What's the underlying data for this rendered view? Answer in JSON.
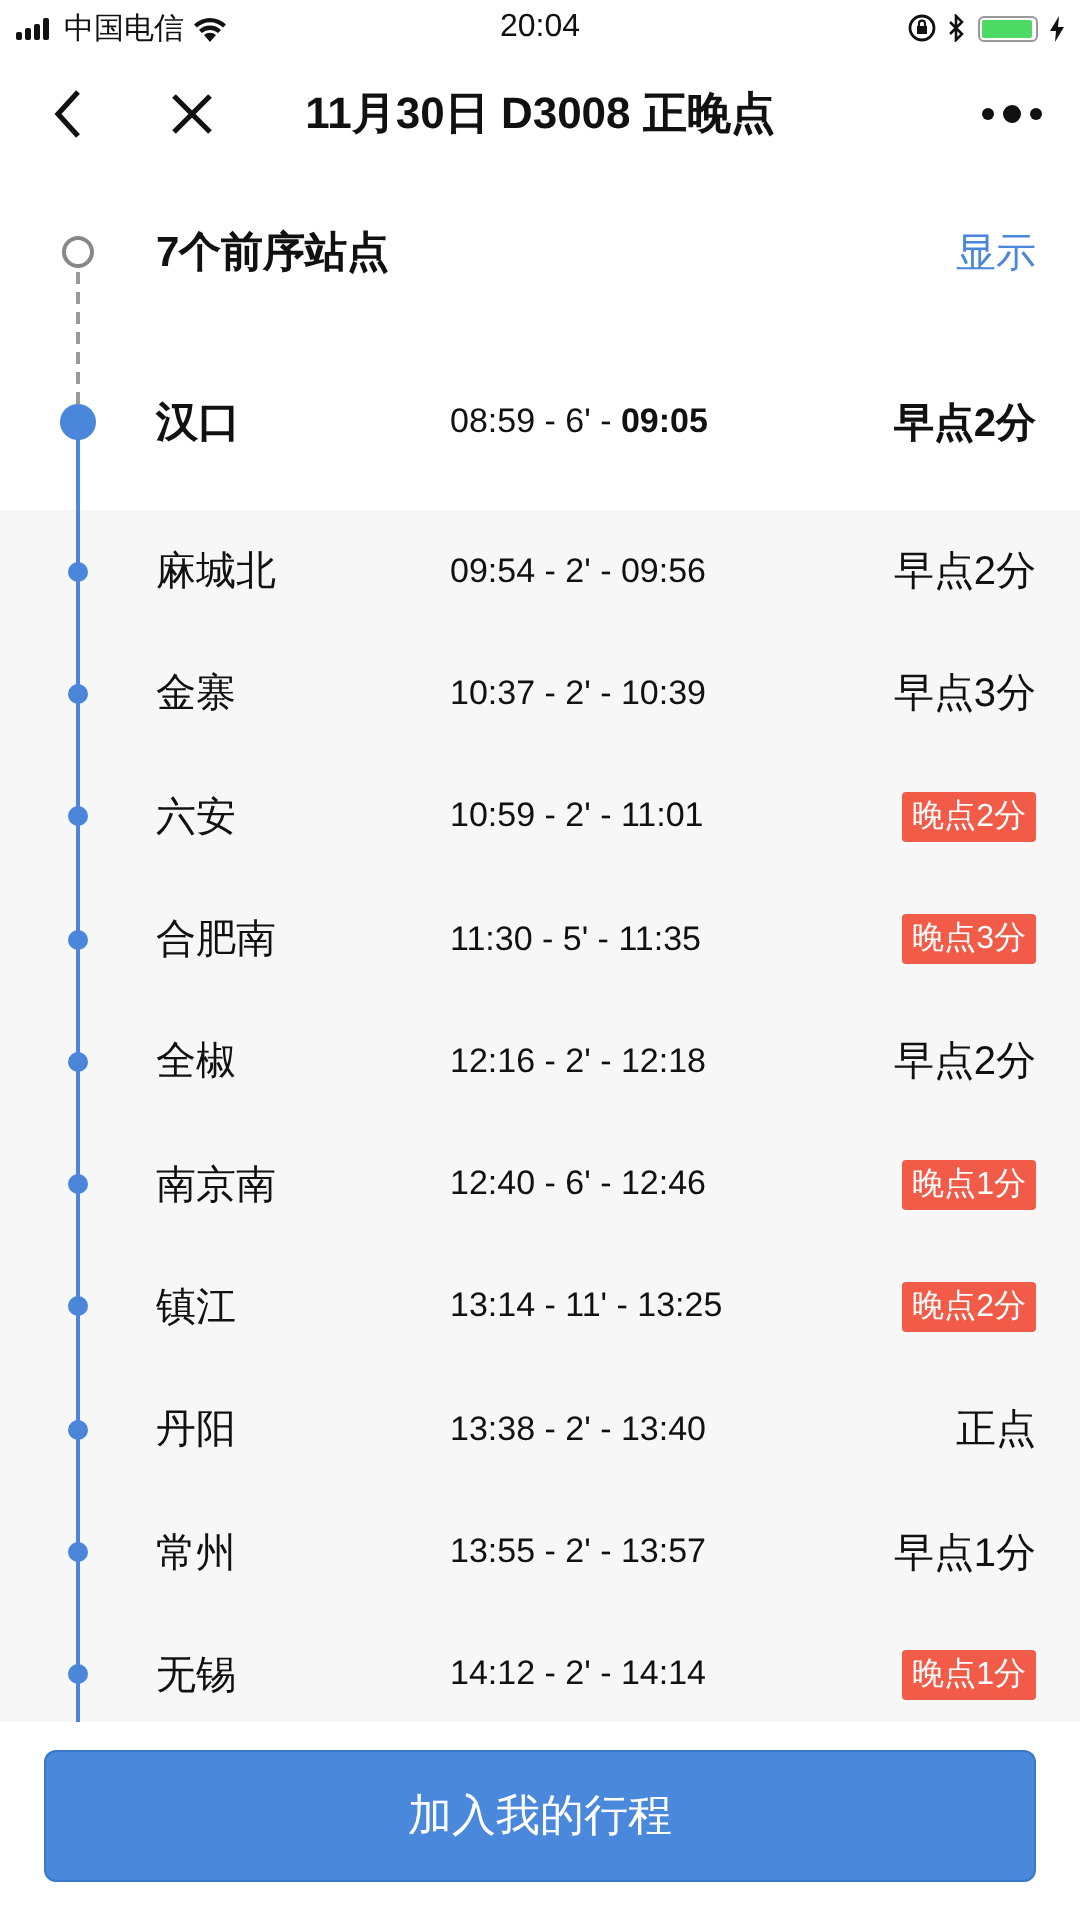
{
  "status_bar": {
    "carrier": "中国电信",
    "time": "20:04"
  },
  "nav": {
    "title": "11月30日 D3008 正晚点"
  },
  "previous": {
    "label": "7个前序站点",
    "action": "显示"
  },
  "origin": {
    "name": "汉口",
    "times": "08:59 - 6' - **09:05**",
    "status": "早点2分"
  },
  "stops": [
    {
      "name": "麻城北",
      "times": "09:54 - 2' - 09:56",
      "status": "早点2分",
      "late": false
    },
    {
      "name": "金寨",
      "times": "10:37 - 2' - 10:39",
      "status": "早点3分",
      "late": false
    },
    {
      "name": "六安",
      "times": "10:59 - 2' - 11:01",
      "status": "晚点2分",
      "late": true
    },
    {
      "name": "合肥南",
      "times": "11:30 - 5' - 11:35",
      "status": "晚点3分",
      "late": true
    },
    {
      "name": "全椒",
      "times": "12:16 - 2' - 12:18",
      "status": "早点2分",
      "late": false
    },
    {
      "name": "南京南",
      "times": "12:40 - 6' - 12:46",
      "status": "晚点1分",
      "late": true
    },
    {
      "name": "镇江",
      "times": "13:14 - 11' - 13:25",
      "status": "晚点2分",
      "late": true
    },
    {
      "name": "丹阳",
      "times": "13:38 - 2' - 13:40",
      "status": "正点",
      "late": false
    },
    {
      "name": "常州",
      "times": "13:55 - 2' - 13:57",
      "status": "早点1分",
      "late": false
    },
    {
      "name": "无锡",
      "times": "14:12 - 2' - 14:14",
      "status": "晚点1分",
      "late": true
    }
  ],
  "button": {
    "label": "加入我的行程"
  }
}
